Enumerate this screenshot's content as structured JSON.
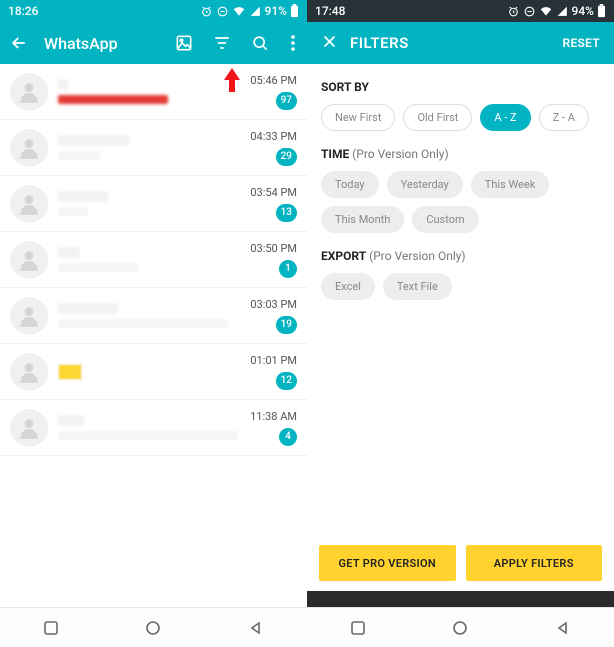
{
  "left": {
    "status": {
      "time": "18:26",
      "battery": "91%"
    },
    "appbar": {
      "title": "WhatsApp"
    },
    "chats": [
      {
        "time": "05:46 PM",
        "badge": "97",
        "nameW": 10,
        "msgW": 0,
        "red": true
      },
      {
        "time": "04:33 PM",
        "badge": "29",
        "nameW": 72,
        "msgW": 42
      },
      {
        "time": "03:54 PM",
        "badge": "13",
        "nameW": 50,
        "msgW": 30
      },
      {
        "time": "03:50 PM",
        "badge": "1",
        "nameW": 22,
        "msgW": 80
      },
      {
        "time": "03:03 PM",
        "badge": "19",
        "nameW": 60,
        "msgW": 170
      },
      {
        "time": "01:01 PM",
        "badge": "12",
        "nameW": 0,
        "msgW": 0,
        "thumb": true
      },
      {
        "time": "11:38 AM",
        "badge": "4",
        "nameW": 26,
        "msgW": 180
      }
    ]
  },
  "right": {
    "status": {
      "time": "17:48",
      "battery": "94%"
    },
    "filters": {
      "title": "FILTERS",
      "reset": "RESET",
      "sections": {
        "sort": {
          "label": "SORT BY",
          "items": [
            {
              "label": "New First",
              "style": "outline"
            },
            {
              "label": "Old First",
              "style": "outline"
            },
            {
              "label": "A - Z",
              "style": "active"
            },
            {
              "label": "Z - A",
              "style": "outline"
            }
          ]
        },
        "time": {
          "label": "TIME",
          "sub": " (Pro Version Only)",
          "items": [
            {
              "label": "Today"
            },
            {
              "label": "Yesterday"
            },
            {
              "label": "This Week"
            },
            {
              "label": "This Month"
            },
            {
              "label": "Custom"
            }
          ]
        },
        "export": {
          "label": "EXPORT",
          "sub": " (Pro Version Only)",
          "items": [
            {
              "label": "Excel"
            },
            {
              "label": "Text File"
            }
          ]
        }
      },
      "actions": {
        "pro": "GET PRO VERSION",
        "apply": "APPLY FILTERS"
      }
    }
  }
}
